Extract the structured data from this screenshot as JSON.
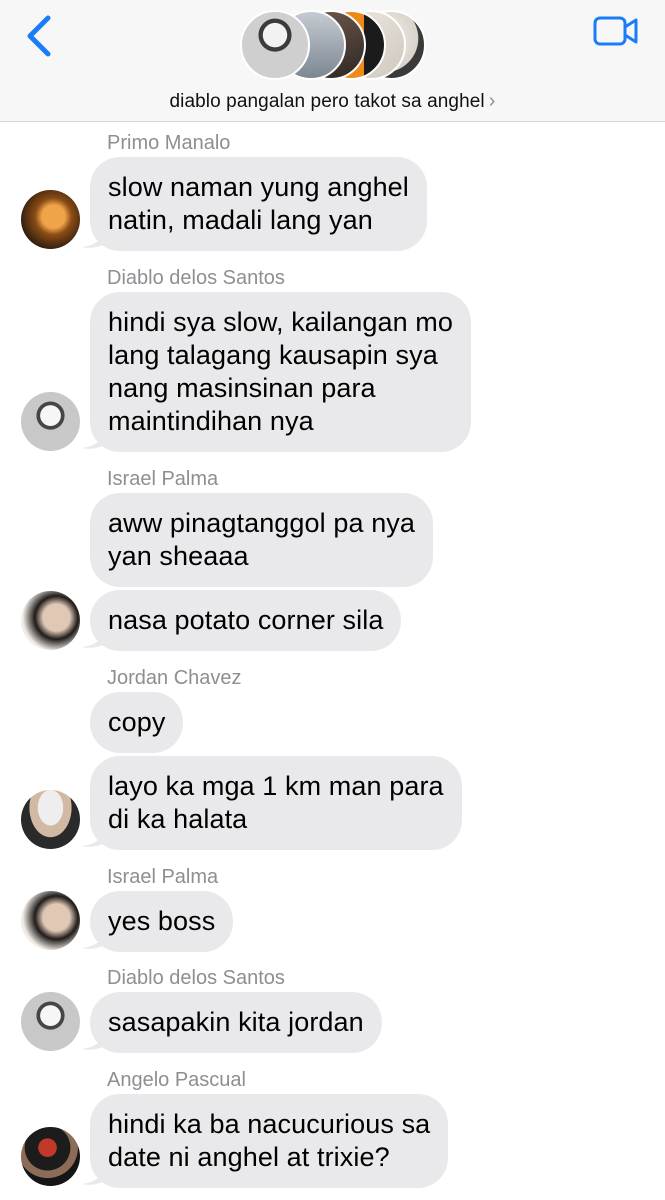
{
  "header": {
    "group_name": "diablo pangalan pero takot sa anghel",
    "chevron": "›",
    "back_icon": "chevron-left-icon",
    "video_icon": "video-camera-icon",
    "accent_color": "#1a7cf7"
  },
  "messages": [
    {
      "sender": "Primo Manalo",
      "text": "slow naman yung anghel\nnatin, madali lang yan"
    },
    {
      "sender": "Diablo delos Santos",
      "text": "hindi sya slow, kailangan mo\nlang talagang kausapin sya\nnang masinsinan para\nmaintindihan nya"
    },
    {
      "sender": "Israel Palma",
      "text": "aww pinagtanggol pa nya\nyan sheaaa"
    },
    {
      "sender": "",
      "text": "nasa potato corner sila"
    },
    {
      "sender": "Jordan Chavez",
      "text": "copy"
    },
    {
      "sender": "",
      "text": "layo ka mga 1 km man para\ndi ka halata"
    },
    {
      "sender": "Israel Palma",
      "text": "yes boss"
    },
    {
      "sender": "Diablo delos Santos",
      "text": "sasapakin kita jordan"
    },
    {
      "sender": "Angelo Pascual",
      "text": "hindi ka ba nacucurious sa\ndate ni anghel at trixie?"
    }
  ]
}
